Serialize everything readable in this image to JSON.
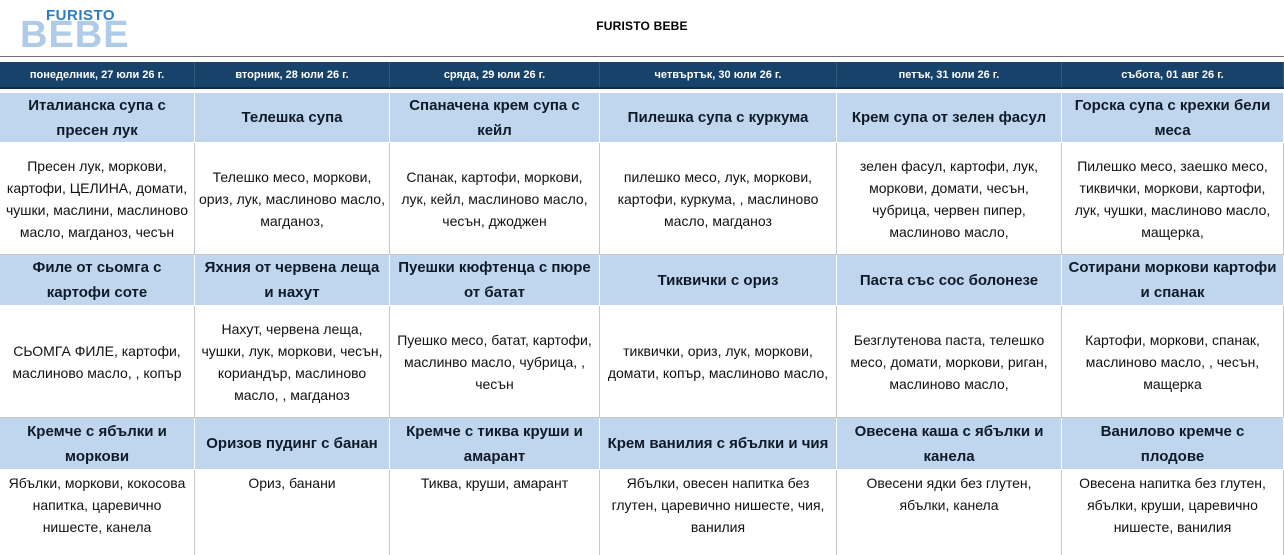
{
  "brand": {
    "small": "FURISTO",
    "big": "BEBE"
  },
  "title": "FURISTO BEBE",
  "days": [
    "понеделник, 27 юли 26 г.",
    "вторник, 28 юли 26 г.",
    "сряда, 29 юли 26 г.",
    "четвъртък, 30 юли 26 г.",
    "петък, 31 юли 26 г.",
    "събота, 01 авг 26 г."
  ],
  "rows": [
    {
      "titles": [
        "Италианска супа с пресен лук",
        "Телешка супа",
        "Спаначена крем супа с кейл",
        "Пилешка супа с куркума",
        "Крем супа от зелен фасул",
        "Горска супа с крехки бели меса"
      ],
      "ingredients": [
        "Пресен лук, моркови, картофи, ЦЕЛИНА, домати, чушки, маслини, маслиново масло, магданоз, чесън",
        "Телешко месо, моркови, ориз, лук, маслиново масло, магданоз,",
        "Спанак, картофи, моркови, лук, кейл, маслиново масло, чесън, джоджен",
        "пилешко месо, лук, моркови, картофи, куркума, , маслиново масло, магданоз",
        "зелен фасул, картофи, лук, моркови, домати, чесън, чубрица, червен пипер, маслиново масло,",
        "Пилешко месо, заешко месо, тиквички, моркови, картофи, лук, чушки, маслиново масло, мащерка,"
      ]
    },
    {
      "titles": [
        "Филе от сьомга с картофи соте",
        "Яхния от червена леща и нахут",
        "Пуешки кюфтенца с пюре от батат",
        "Тиквички с ориз",
        "Паста със сос болонезе",
        "Сотирани моркови картофи и спанак"
      ],
      "ingredients": [
        "СЬОМГА ФИЛЕ, картофи, маслиново масло, , копър",
        "Нахут, червена леща, чушки, лук, моркови, чесън, кориандър, маслиново масло, , магданоз",
        "Пуешко месо, батат, картофи, маслинво масло, чубрица, , чесън",
        "тиквички, ориз, лук, моркови, домати, копър, маслиново масло,",
        "Безглутенова паста, телешко месо, домати, моркови, риган, маслиново масло,",
        "Картофи, моркови, спанак, маслиново масло, , чесън, мащерка"
      ]
    },
    {
      "titles": [
        "Кремче с ябълки и моркови",
        "Оризов пудинг с банан",
        "Кремче с тиква круши и амарант",
        "Крем ванилия с ябълки и чия",
        "Овесена каша с ябълки и канела",
        "Ванилово кремче с плодове"
      ],
      "ingredients": [
        "Ябълки, моркови, кокосова напитка, царевично нишесте, канела",
        "Ориз, банани",
        "Тиква, круши, амарант",
        "Ябълки, овесен напитка без глутен, царевично нишесте, чия, ванилия",
        "Овесени ядки без глутен, ябълки, канела",
        "Овесена напитка без глутен, ябълки, круши, царевично нишесте, ванилия"
      ]
    }
  ]
}
